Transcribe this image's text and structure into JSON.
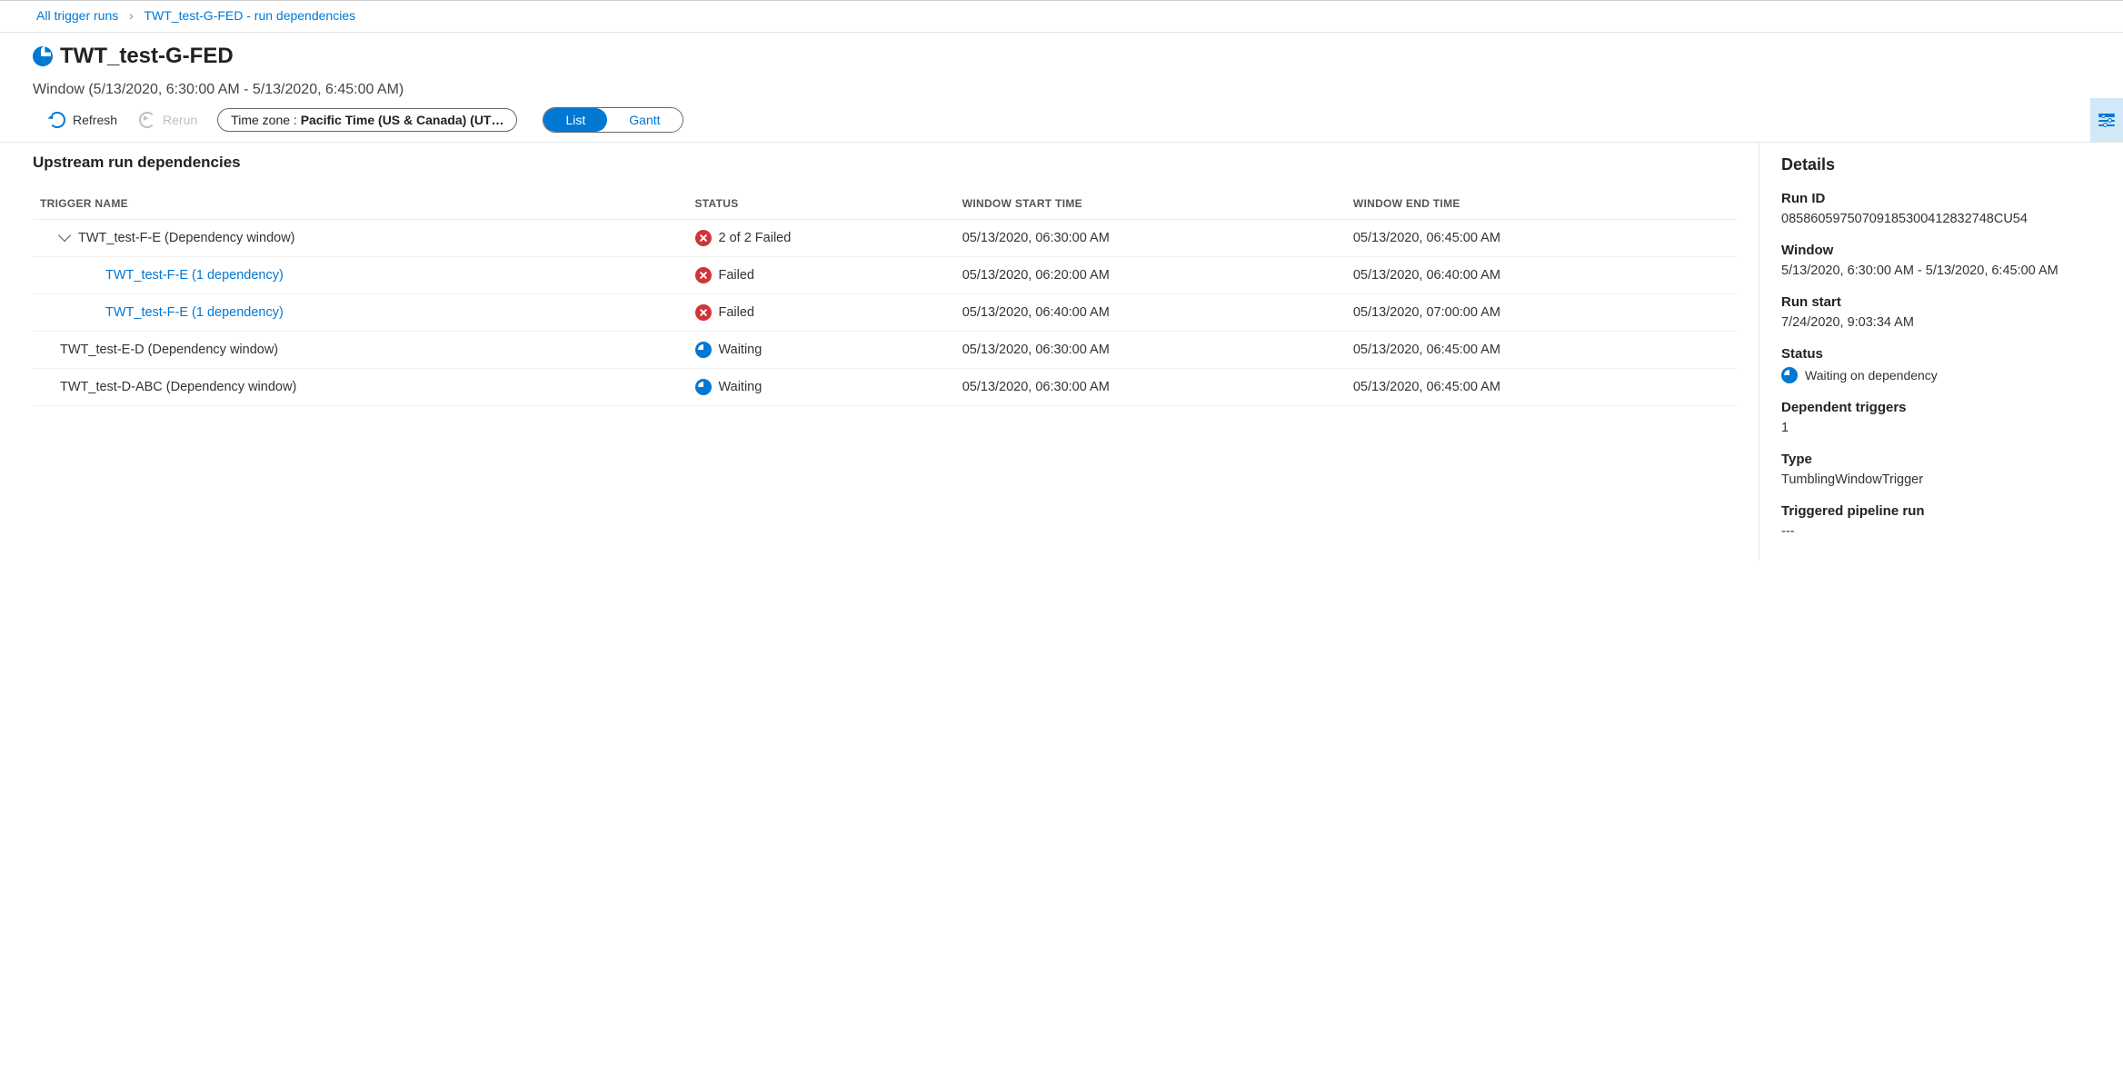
{
  "breadcrumb": {
    "root": "All trigger runs",
    "current": "TWT_test-G-FED - run dependencies"
  },
  "page_title": "TWT_test-G-FED",
  "window_line": "Window (5/13/2020, 6:30:00 AM - 5/13/2020, 6:45:00 AM)",
  "toolbar": {
    "refresh": "Refresh",
    "rerun": "Rerun",
    "timezone_prefix": "Time zone : ",
    "timezone_value": "Pacific Time (US & Canada) (UT…",
    "list": "List",
    "gantt": "Gantt"
  },
  "upstream_heading": "Upstream run dependencies",
  "columns": {
    "trigger_name": "TRIGGER NAME",
    "status": "STATUS",
    "window_start": "WINDOW START TIME",
    "window_end": "WINDOW END TIME"
  },
  "rows": [
    {
      "depth": 1,
      "expandable": true,
      "link": false,
      "name": "TWT_test-F-E (Dependency window)",
      "status_icon": "fail",
      "status_text": "2 of 2 Failed",
      "start": "05/13/2020, 06:30:00 AM",
      "end": "05/13/2020, 06:45:00 AM"
    },
    {
      "depth": 2,
      "expandable": false,
      "link": true,
      "name": "TWT_test-F-E (1 dependency)",
      "status_icon": "fail",
      "status_text": "Failed",
      "start": "05/13/2020, 06:20:00 AM",
      "end": "05/13/2020, 06:40:00 AM"
    },
    {
      "depth": 2,
      "expandable": false,
      "link": true,
      "name": "TWT_test-F-E (1 dependency)",
      "status_icon": "fail",
      "status_text": "Failed",
      "start": "05/13/2020, 06:40:00 AM",
      "end": "05/13/2020, 07:00:00 AM"
    },
    {
      "depth": 1,
      "expandable": false,
      "link": false,
      "name": "TWT_test-E-D (Dependency window)",
      "status_icon": "wait",
      "status_text": "Waiting",
      "start": "05/13/2020, 06:30:00 AM",
      "end": "05/13/2020, 06:45:00 AM"
    },
    {
      "depth": 1,
      "expandable": false,
      "link": false,
      "name": "TWT_test-D-ABC (Dependency window)",
      "status_icon": "wait",
      "status_text": "Waiting",
      "start": "05/13/2020, 06:30:00 AM",
      "end": "05/13/2020, 06:45:00 AM"
    }
  ],
  "details": {
    "heading": "Details",
    "run_id_label": "Run ID",
    "run_id": "08586059750709185300412832748CU54",
    "window_label": "Window",
    "window": "5/13/2020, 6:30:00 AM - 5/13/2020, 6:45:00 AM",
    "run_start_label": "Run start",
    "run_start": "7/24/2020, 9:03:34 AM",
    "status_label": "Status",
    "status_text": "Waiting on dependency",
    "dependent_label": "Dependent triggers",
    "dependent": "1",
    "type_label": "Type",
    "type": "TumblingWindowTrigger",
    "triggered_label": "Triggered pipeline run",
    "triggered": "---"
  }
}
